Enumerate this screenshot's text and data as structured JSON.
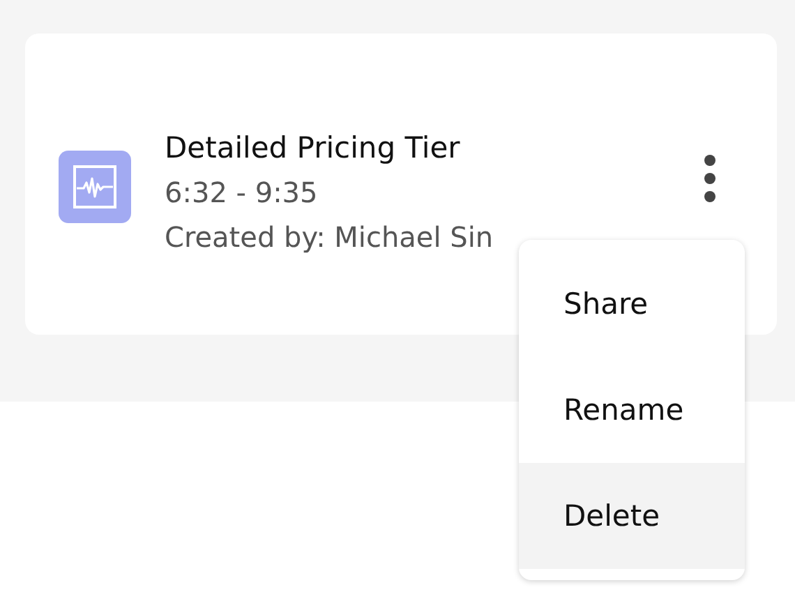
{
  "card": {
    "title": "Detailed Pricing Tier",
    "time_range": "6:32 - 9:35",
    "created_by": "Created by: Michael Sin"
  },
  "menu": {
    "items": [
      {
        "label": "Share",
        "selected": false
      },
      {
        "label": "Rename",
        "selected": false
      },
      {
        "label": "Delete",
        "selected": true
      }
    ]
  }
}
